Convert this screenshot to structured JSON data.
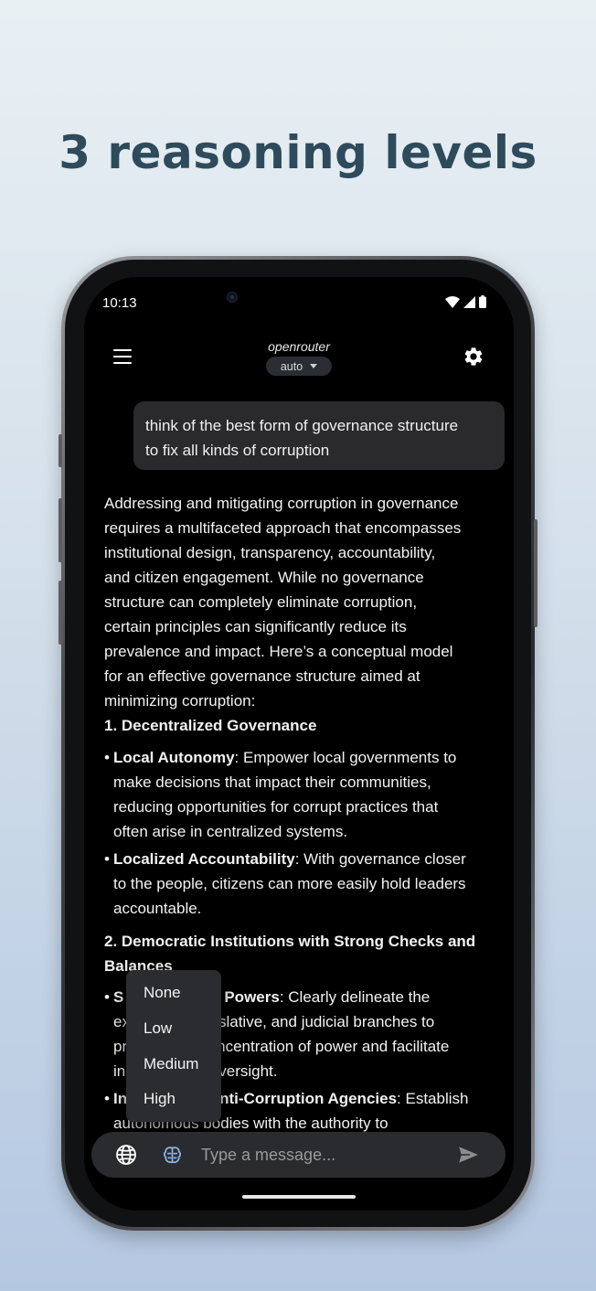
{
  "headline": "3 reasoning levels",
  "status": {
    "time": "10:13"
  },
  "topbar": {
    "title": "openrouter",
    "model": "auto"
  },
  "user_message": {
    "line1": "think of the best form of governance structure",
    "line2": "to fix all kinds of corruption"
  },
  "answer": {
    "intro": [
      "Addressing and mitigating corruption in governance",
      "requires a multifaceted approach that encompasses",
      "institutional design, transparency, accountability,",
      "and citizen engagement. While no governance",
      "structure can completely eliminate corruption,",
      "certain principles can significantly reduce its",
      "prevalence and impact. Here’s a conceptual model",
      "for an effective governance structure aimed at",
      "minimizing corruption:"
    ],
    "section1": "1. Decentralized Governance",
    "bullet1": {
      "term": "Local Autonomy",
      "lines": [
        ": Empower local governments to",
        "make decisions that impact their communities,",
        "reducing opportunities for corrupt practices that",
        "often arise in centralized systems."
      ]
    },
    "bullet2": {
      "term": "Localized Accountability",
      "lines": [
        ": With governance closer",
        "to the people, citizens can more easily hold leaders",
        "accountable."
      ]
    },
    "section2_line1": "2. Democratic Institutions with Strong Checks and",
    "section2_line2": "Balances",
    "bullet3": {
      "prefix": "S",
      "term": "Powers",
      "lines": [
        ": Clearly delineate the",
        "slative, and judicial branches to",
        "ncentration of power and facilitate",
        "versight."
      ],
      "left_fragments": [
        "ex",
        "pr",
        "in"
      ]
    },
    "bullet4": {
      "prefix": "In",
      "term": "nti-Corruption Agencies",
      "rest": ": Establish",
      "line2": "autonomous bodies with the authority to"
    }
  },
  "reasoning_menu": {
    "items": [
      "None",
      "Low",
      "Medium",
      "High"
    ]
  },
  "input": {
    "placeholder": "Type a message..."
  },
  "icons": {
    "menu": "menu-icon",
    "settings": "gear-icon",
    "web": "globe-icon",
    "reasoning": "brain-icon",
    "send": "send-icon"
  },
  "colors": {
    "headline": "#2e4b5c",
    "screen_bg": "#000000",
    "bubble": "#2a2a2c",
    "brain_accent": "#8fb3e8"
  }
}
